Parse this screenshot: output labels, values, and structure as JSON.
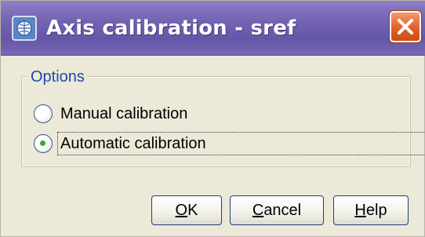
{
  "window": {
    "title": "Axis calibration - sref",
    "icons": {
      "app": "app-globe-icon",
      "close": "close-x-icon"
    },
    "colors": {
      "titlebar": "#7464b3",
      "close_button": "#e0602a",
      "group_label": "#1a4ab0",
      "radio_dot": "#2fb02a"
    }
  },
  "options": {
    "label": "Options",
    "items": [
      {
        "label": "Manual calibration",
        "selected": false
      },
      {
        "label": "Automatic calibration",
        "selected": true
      }
    ]
  },
  "buttons": {
    "ok": {
      "mnemonic": "O",
      "rest": "K"
    },
    "cancel": {
      "mnemonic": "C",
      "rest": "ancel"
    },
    "help": {
      "mnemonic": "H",
      "rest": "elp"
    }
  }
}
